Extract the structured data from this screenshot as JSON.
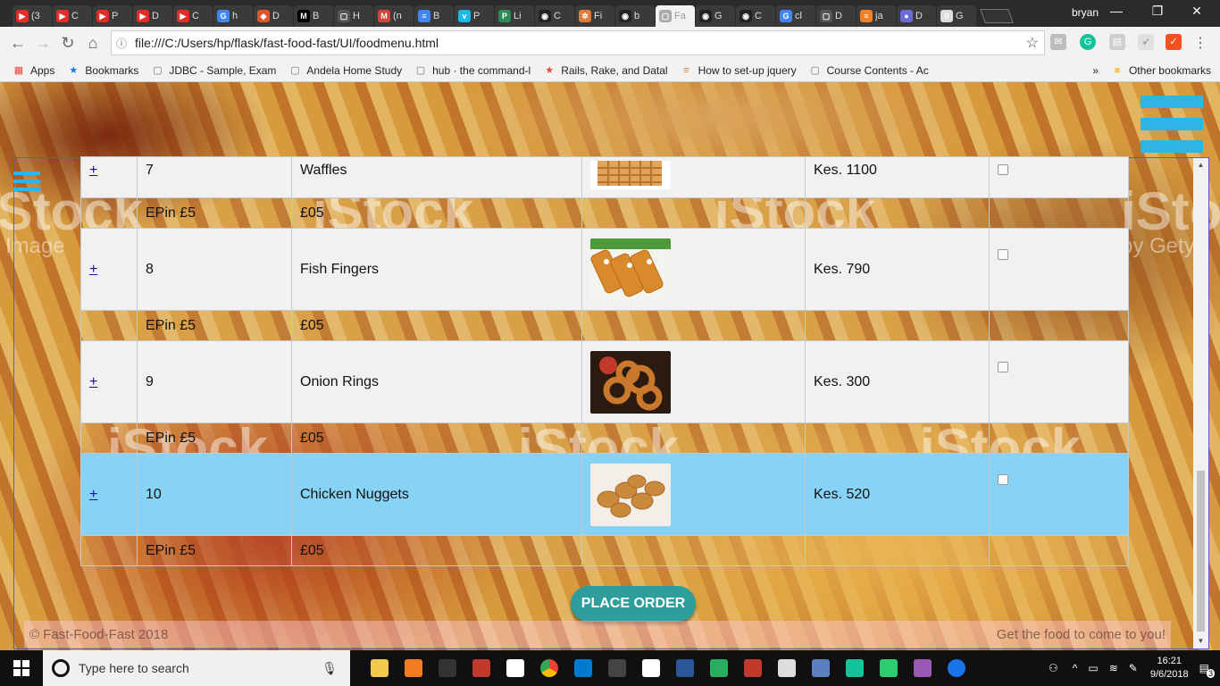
{
  "browser": {
    "tabs": [
      {
        "label": "(3",
        "icon": "youtube-icon",
        "color": "#e52d27"
      },
      {
        "label": "C",
        "icon": "youtube-icon",
        "color": "#e52d27"
      },
      {
        "label": "P",
        "icon": "youtube-icon",
        "color": "#e52d27"
      },
      {
        "label": "D",
        "icon": "youtube-icon",
        "color": "#e52d27"
      },
      {
        "label": "C",
        "icon": "youtube-icon",
        "color": "#e52d27"
      },
      {
        "label": "h",
        "icon": "google-icon",
        "color": "#4285f4"
      },
      {
        "label": "D",
        "icon": "shield-icon",
        "color": "#e0562b"
      },
      {
        "label": "B",
        "icon": "medium-icon",
        "color": "#000000"
      },
      {
        "label": "H",
        "icon": "page-icon",
        "color": "#555555"
      },
      {
        "label": "(n",
        "icon": "gmail-icon",
        "color": "#d44638"
      },
      {
        "label": "B",
        "icon": "docs-icon",
        "color": "#4285f4"
      },
      {
        "label": "P",
        "icon": "vimeo-icon",
        "color": "#1ab7ea"
      },
      {
        "label": "Li",
        "icon": "pivotal-icon",
        "color": "#2e8b57"
      },
      {
        "label": "C",
        "icon": "github-icon",
        "color": "#222222"
      },
      {
        "label": "Fi",
        "icon": "gear-icon",
        "color": "#e07b39"
      },
      {
        "label": "b",
        "icon": "github-icon",
        "color": "#222222"
      },
      {
        "label": "Fa",
        "icon": "page-icon",
        "color": "#aaaaaa",
        "active": true
      },
      {
        "label": "G",
        "icon": "github-icon",
        "color": "#222222"
      },
      {
        "label": "C",
        "icon": "github-icon",
        "color": "#222222"
      },
      {
        "label": "cl",
        "icon": "google-icon",
        "color": "#4285f4"
      },
      {
        "label": "D",
        "icon": "page-icon",
        "color": "#555555"
      },
      {
        "label": "ja",
        "icon": "stackoverflow-icon",
        "color": "#f48024"
      },
      {
        "label": "D",
        "icon": "circle-icon",
        "color": "#6b6bd6"
      },
      {
        "label": "G",
        "icon": "box-icon",
        "color": "#dddddd"
      }
    ],
    "user": "bryan",
    "url": "file:///C:/Users/hp/flask/fast-food-fast/UI/foodmenu.html",
    "bookmarks": [
      {
        "label": "Apps",
        "icon": "apps-grid-icon"
      },
      {
        "label": "Bookmarks",
        "icon": "star-icon"
      },
      {
        "label": "JDBC - Sample, Exam",
        "icon": "bookmark-page-icon"
      },
      {
        "label": "Andela Home Study",
        "icon": "bookmark-page-icon"
      },
      {
        "label": "hub · the command-l",
        "icon": "bookmark-page-icon"
      },
      {
        "label": "Rails, Rake, and Datal",
        "icon": "star-icon"
      },
      {
        "label": "How to set-up jquery",
        "icon": "stackoverflow-icon"
      },
      {
        "label": "Course Contents - Ac",
        "icon": "bookmark-page-icon"
      }
    ],
    "other_bookmarks": "Other bookmarks",
    "overflow": "»"
  },
  "page": {
    "watermark": "iStock",
    "watermark_sub": "Image",
    "watermark_sub2": "by Gety",
    "partial_row": {
      "num": "7",
      "name": "Waffles",
      "price": "Kes. 1100"
    },
    "items": [
      {
        "add": "+",
        "num": "8",
        "name": "Fish Fingers",
        "price": "Kes. 790",
        "image": "fish-fingers",
        "highlight": false
      },
      {
        "add": "+",
        "num": "9",
        "name": "Onion Rings",
        "price": "Kes. 300",
        "image": "onion-rings",
        "highlight": false
      },
      {
        "add": "+",
        "num": "10",
        "name": "Chicken Nuggets",
        "price": "Kes. 520",
        "image": "chicken-nuggets",
        "highlight": true
      }
    ],
    "sub_row": {
      "col2": "EPin £5",
      "col3": "£05"
    },
    "place_order": "PLACE ORDER",
    "footer_left": "© Fast-Food-Fast 2018",
    "footer_right": "Get the food to come to you!"
  },
  "taskbar": {
    "search_placeholder": "Type here to search",
    "time": "16:21",
    "date": "9/6/2018",
    "notifications": "3"
  }
}
